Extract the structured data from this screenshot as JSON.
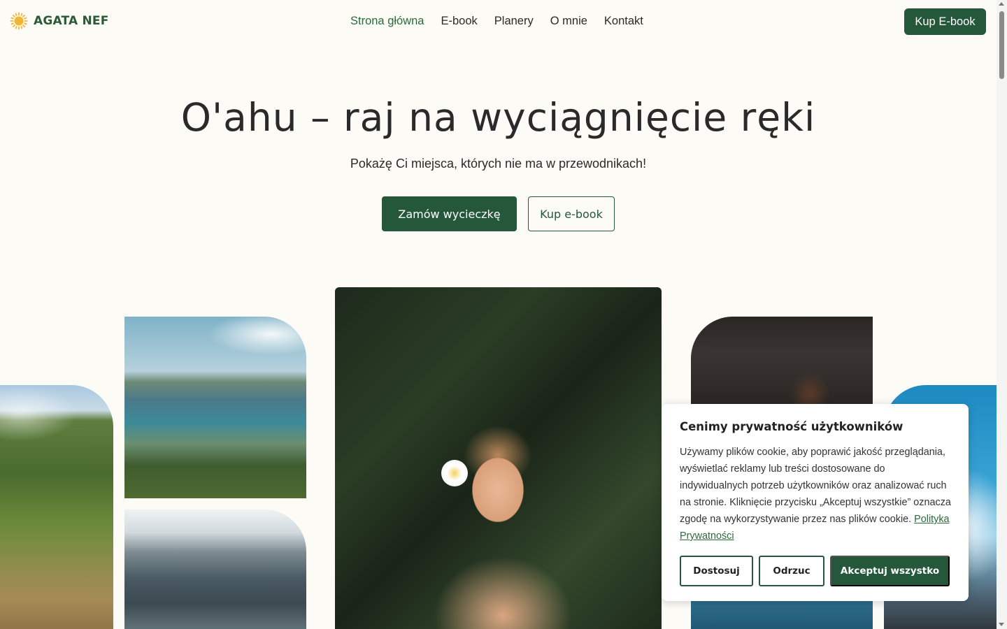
{
  "brand": {
    "name": "AGATA NEF",
    "icon": "sun-icon"
  },
  "nav": {
    "items": [
      {
        "label": "Strona główna",
        "active": true
      },
      {
        "label": "E-book",
        "active": false
      },
      {
        "label": "Planery",
        "active": false
      },
      {
        "label": "O mnie",
        "active": false
      },
      {
        "label": "Kontakt",
        "active": false
      }
    ],
    "cta_label": "Kup E-book"
  },
  "hero": {
    "title": "O'ahu – raj na wyciągnięcie ręki",
    "subtitle": "Pokażę Ci miejsca, których nie ma w przewodnikach!",
    "primary_button": "Zamów wycieczkę",
    "secondary_button": "Kup e-book"
  },
  "cookie_banner": {
    "title": "Cenimy prywatność użytkowników",
    "text": "Używamy plików cookie, aby poprawić jakość przeglądania, wyświetlać reklamy lub treści dostosowane do indywidualnych potrzeb użytkowników oraz analizować ruch na stronie. Kliknięcie przycisku „Akceptuj wszystkie” oznacza zgodę na wykorzystywanie przez nas plików cookie.",
    "link_label": "Polityka Prywatności",
    "buttons": {
      "customize": "Dostosuj",
      "reject": "Odrzuc",
      "accept": "Akceptuj wszystko"
    }
  },
  "colors": {
    "brand_green": "#25573a",
    "active_link": "#2b6b3b",
    "background": "#fcfbf6",
    "logo_sun": "#f2b632"
  }
}
